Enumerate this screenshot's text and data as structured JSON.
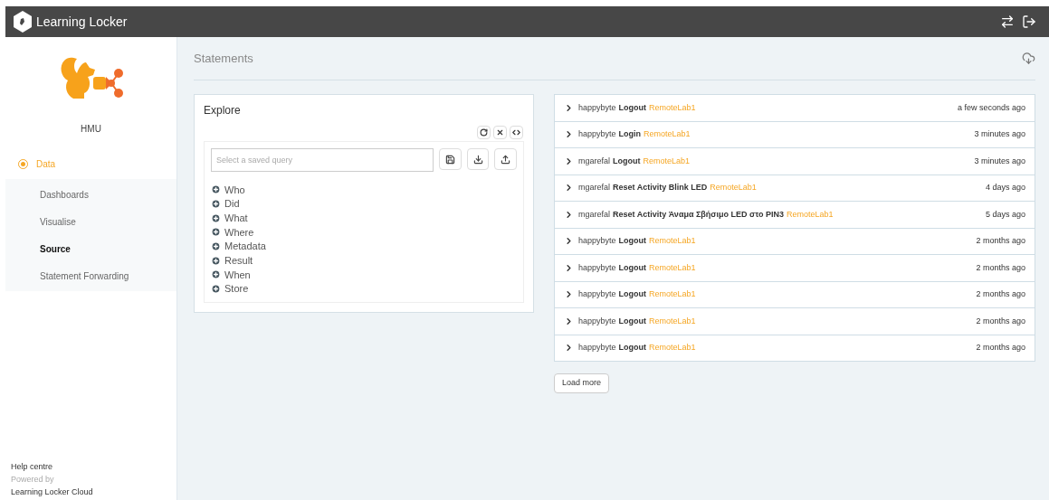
{
  "header": {
    "title": "Learning Locker"
  },
  "sidebar": {
    "org": "HMU",
    "section": {
      "label": "Data",
      "selected": true
    },
    "items": [
      {
        "label": "Dashboards",
        "selected": false
      },
      {
        "label": "Visualise",
        "selected": false
      },
      {
        "label": "Source",
        "selected": true
      },
      {
        "label": "Statement Forwarding",
        "selected": false
      }
    ],
    "footer": {
      "help": "Help centre",
      "powered": "Powered by",
      "product": "Learning Locker Cloud"
    }
  },
  "page": {
    "title": "Statements"
  },
  "explore": {
    "title": "Explore",
    "query": {
      "placeholder": "Select a saved query"
    },
    "filters": [
      "Who",
      "Did",
      "What",
      "Where",
      "Metadata",
      "Result",
      "When",
      "Store"
    ]
  },
  "statements": [
    {
      "actor": "happybyte",
      "verb": "Logout",
      "object": "RemoteLab1",
      "time": "a few seconds ago",
      "expanded": false
    },
    {
      "actor": "happybyte",
      "verb": "Login",
      "object": "RemoteLab1",
      "time": "3 minutes ago",
      "expanded": false
    },
    {
      "actor": "mgarefal",
      "verb": "Logout",
      "object": "RemoteLab1",
      "time": "3 minutes ago",
      "expanded": false
    },
    {
      "actor": "mgarefal",
      "verb": "Reset Activity Blink LED",
      "object": "RemoteLab1",
      "time": "4 days ago",
      "expanded": false
    },
    {
      "actor": "mgarefal",
      "verb": "Reset Activity Άναμα Σβήσιμο LED στο PIN3",
      "object": "RemoteLab1",
      "time": "5 days ago",
      "expanded": false
    },
    {
      "actor": "happybyte",
      "verb": "Logout",
      "object": "RemoteLab1",
      "time": "2 months ago",
      "expanded": false
    },
    {
      "actor": "happybyte",
      "verb": "Logout",
      "object": "RemoteLab1",
      "time": "2 months ago",
      "expanded": false
    },
    {
      "actor": "happybyte",
      "verb": "Logout",
      "object": "RemoteLab1",
      "time": "2 months ago",
      "expanded": false
    },
    {
      "actor": "happybyte",
      "verb": "Logout",
      "object": "RemoteLab1",
      "time": "2 months ago",
      "expanded": false
    },
    {
      "actor": "happybyte",
      "verb": "Logout",
      "object": "RemoteLab1",
      "time": "2 months ago",
      "expanded": false
    }
  ],
  "load_more": "Load more"
}
